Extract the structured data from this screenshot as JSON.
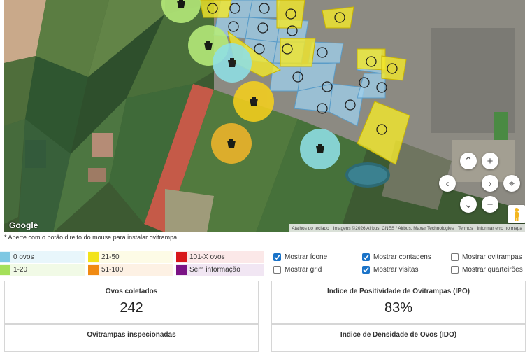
{
  "map": {
    "google_logo": "Google",
    "attribution": {
      "keyboard": "Atalhos do teclado",
      "imagery": "Imagens ©2026 Airbus, CNES / Airbus, Maxar Technologies",
      "terms": "Termos",
      "report": "Informar erro no mapa"
    },
    "controls": {
      "up_icon": "chevron-up-icon",
      "zoom_in_label": "+",
      "left_icon": "chevron-left-icon",
      "right_icon": "chevron-right-icon",
      "down_icon": "chevron-down-icon",
      "zoom_out_label": "−",
      "center_icon": "crosshair-icon",
      "pegman_icon": "pegman-icon"
    }
  },
  "hint": "* Aperte com o botão direito do mouse para instalar ovitrampa",
  "legend": [
    {
      "label": "0 ovos",
      "color": "#7ec8e3",
      "bg": "#e8f6fb"
    },
    {
      "label": "21-50",
      "color": "#f2e31b",
      "bg": "#fdfbe6"
    },
    {
      "label": "101-X ovos",
      "color": "#d8171a",
      "bg": "#fbe8e8"
    },
    {
      "label": "1-20",
      "color": "#a5e05a",
      "bg": "#f1fae6"
    },
    {
      "label": "51-100",
      "color": "#f08a12",
      "bg": "#fdf1e4"
    },
    {
      "label": "Sem informação",
      "color": "#7b1385",
      "bg": "#f1e6f3"
    }
  ],
  "options": [
    {
      "label": "Mostrar ícone",
      "checked": true
    },
    {
      "label": "Mostrar contagens",
      "checked": true
    },
    {
      "label": "Mostrar ovitrampas",
      "checked": false
    },
    {
      "label": "Mostrar grid",
      "checked": false
    },
    {
      "label": "Mostrar visitas",
      "checked": true
    },
    {
      "label": "Mostrar quarteirões",
      "checked": false
    }
  ],
  "stats": [
    {
      "title": "Ovos coletados",
      "value": "242"
    },
    {
      "title": "Indice de Positividade de Ovitrampas (IPO)",
      "value": "83%"
    },
    {
      "title": "Ovitrampas inspecionadas",
      "value": ""
    },
    {
      "title": "Indice de Densidade de Ovos (IDO)",
      "value": ""
    }
  ],
  "colors": {
    "checkbox_on": "#1a73c8",
    "zone_blue": "#9fd0ee",
    "zone_yellow": "#f4e92a",
    "circle_green": "#b7ec7a",
    "circle_yellow": "#f5cf1d",
    "circle_orange": "#f0b52a",
    "circle_cyan": "#8fe0e6"
  }
}
